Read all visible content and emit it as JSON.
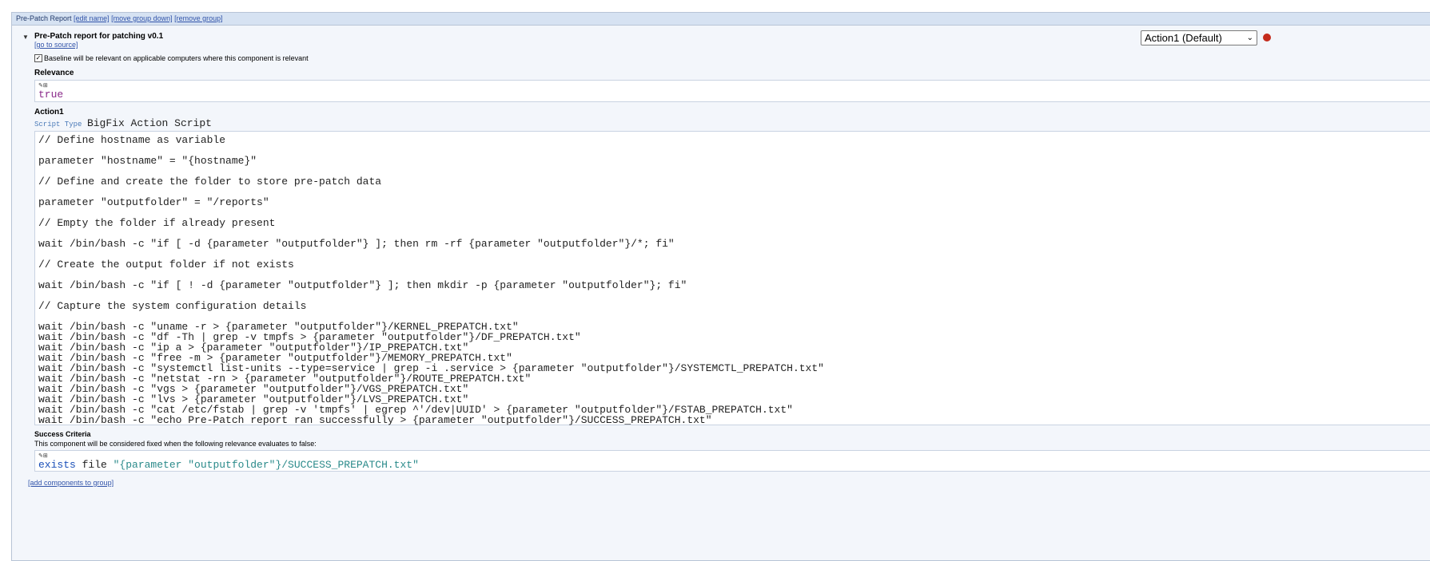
{
  "group": {
    "title": "Pre-Patch Report",
    "links": [
      "[edit name]",
      "[move group down]",
      "[remove group]"
    ]
  },
  "component": {
    "toggle_icon": "triangle-down-icon",
    "title": "Pre-Patch report for patching v0.1",
    "goto_source": "[go to source]",
    "action_select": "Action1 (Default)",
    "baseline_checked": true,
    "baseline_text": "Baseline will be relevant on applicable computers where this component is relevant",
    "relevance_label": "Relevance",
    "relevance_value": "true",
    "action_label": "Action1",
    "script_type_label": "Script Type",
    "script_type_value": "BigFix Action Script",
    "script_lines": [
      "// Define hostname as variable",
      "",
      "parameter \"hostname\" = \"{hostname}\"",
      "",
      "// Define and create the folder to store pre-patch data",
      "",
      "parameter \"outputfolder\" = \"/reports\"",
      "",
      "// Empty the folder if already present",
      "",
      "wait /bin/bash -c \"if [ -d {parameter \"outputfolder\"} ]; then rm -rf {parameter \"outputfolder\"}/*; fi\"",
      "",
      "// Create the output folder if not exists",
      "",
      "wait /bin/bash -c \"if [ ! -d {parameter \"outputfolder\"} ]; then mkdir -p {parameter \"outputfolder\"}; fi\"",
      "",
      "// Capture the system configuration details",
      "",
      "wait /bin/bash -c \"uname -r > {parameter \"outputfolder\"}/KERNEL_PREPATCH.txt\"",
      "wait /bin/bash -c \"df -Th | grep -v tmpfs > {parameter \"outputfolder\"}/DF_PREPATCH.txt\"",
      "wait /bin/bash -c \"ip a > {parameter \"outputfolder\"}/IP_PREPATCH.txt\"",
      "wait /bin/bash -c \"free -m > {parameter \"outputfolder\"}/MEMORY_PREPATCH.txt\"",
      "wait /bin/bash -c \"systemctl list-units --type=service | grep -i .service > {parameter \"outputfolder\"}/SYSTEMCTL_PREPATCH.txt\"",
      "wait /bin/bash -c \"netstat -rn > {parameter \"outputfolder\"}/ROUTE_PREPATCH.txt\"",
      "wait /bin/bash -c \"vgs > {parameter \"outputfolder\"}/VGS_PREPATCH.txt\"",
      "wait /bin/bash -c \"lvs > {parameter \"outputfolder\"}/LVS_PREPATCH.txt\"",
      "wait /bin/bash -c \"cat /etc/fstab | grep -v 'tmpfs' | egrep ^'/dev|UUID' > {parameter \"outputfolder\"}/FSTAB_PREPATCH.txt\"",
      "wait /bin/bash -c \"echo Pre-Patch report ran successfully > {parameter \"outputfolder\"}/SUCCESS_PREPATCH.txt\""
    ],
    "success_label": "Success Criteria",
    "success_note": "This component will be considered fixed when the following relevance evaluates to false:",
    "success_keyword": "exists",
    "success_mid": " file ",
    "success_string": "\"{parameter \"outputfolder\"}/SUCCESS_PREPATCH.txt\""
  },
  "footer": {
    "add_components": "[add components to group]"
  }
}
